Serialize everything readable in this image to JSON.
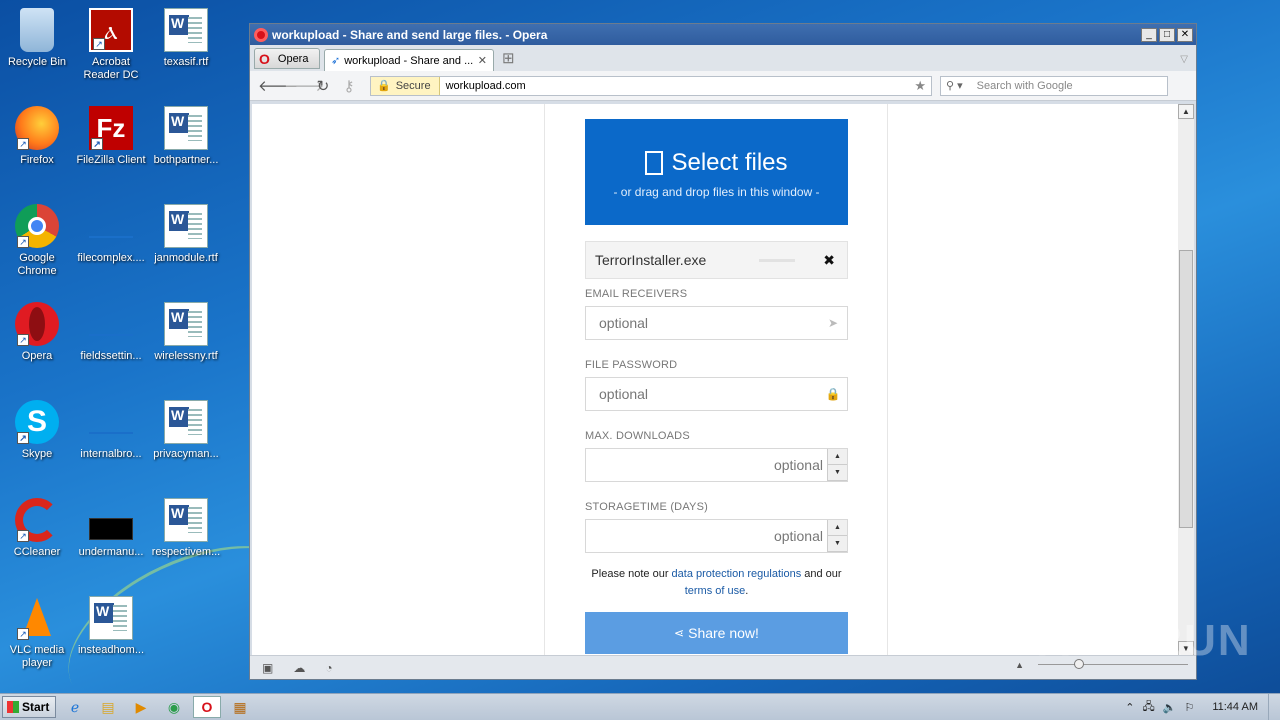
{
  "desktop": {
    "col1": [
      {
        "label": "Recycle Bin",
        "icon": "recycle-bin-icon",
        "glyph": "🗑"
      },
      {
        "label": "Firefox",
        "icon": "firefox-icon",
        "glyph": "🦊"
      },
      {
        "label": "Google Chrome",
        "icon": "chrome-icon",
        "glyph": "◉"
      },
      {
        "label": "Opera",
        "icon": "opera-icon",
        "glyph": "O"
      },
      {
        "label": "Skype",
        "icon": "skype-icon",
        "glyph": "S"
      },
      {
        "label": "CCleaner",
        "icon": "ccleaner-icon",
        "glyph": "C"
      },
      {
        "label": "VLC media player",
        "icon": "vlc-icon",
        "glyph": "▲"
      }
    ],
    "col2": [
      {
        "label": "Acrobat Reader DC",
        "icon": "acrobat-icon"
      },
      {
        "label": "FileZilla Client",
        "icon": "filezilla-icon"
      },
      {
        "label": "filecomplex....",
        "icon": "blank-file-icon"
      },
      {
        "label": "fieldssettin...",
        "icon": "blank-file-icon"
      },
      {
        "label": "internalbro...",
        "icon": "blank-file-icon"
      },
      {
        "label": "undermanu...",
        "icon": "black-file-icon"
      },
      {
        "label": "insteadhom...",
        "icon": "word-doc-icon"
      }
    ],
    "col3": [
      {
        "label": "texasif.rtf",
        "icon": "word-doc-icon"
      },
      {
        "label": "bothpartner...",
        "icon": "word-doc-icon"
      },
      {
        "label": "janmodule.rtf",
        "icon": "word-doc-icon"
      },
      {
        "label": "wirelessny.rtf",
        "icon": "word-doc-icon"
      },
      {
        "label": "privacyman...",
        "icon": "word-doc-icon"
      },
      {
        "label": "respectivem...",
        "icon": "word-doc-icon"
      }
    ]
  },
  "window": {
    "title": "workupload - Share and send large files. - Opera",
    "menu_label": "Opera",
    "tab_title": "workupload - Share and ...",
    "secure_label": "Secure",
    "url": "workupload.com",
    "search_placeholder": "Search with Google"
  },
  "upload": {
    "select_title": "Select files",
    "select_sub": "- or drag and drop files in this window -",
    "file_name": "TerrorInstaller.exe",
    "email_label": "EMAIL RECEIVERS",
    "email_placeholder": "optional",
    "password_label": "FILE PASSWORD",
    "password_placeholder": "optional",
    "downloads_label": "MAX. DOWNLOADS",
    "downloads_placeholder": "optional",
    "storage_label": "STORAGETIME (DAYS)",
    "storage_placeholder": "optional",
    "note_prefix": "Please note our",
    "note_link1": "data protection regulations",
    "note_mid": "and our",
    "note_link2": "terms of use",
    "note_suffix": ".",
    "share_label": "Share now!"
  },
  "watermark": "ANY RUN",
  "taskbar": {
    "start_label": "Start",
    "clock": "11:44 AM"
  },
  "colors": {
    "primary_blue": "#0b69c9",
    "share_blue": "#5b9de2",
    "link_blue": "#1a5aa5"
  }
}
